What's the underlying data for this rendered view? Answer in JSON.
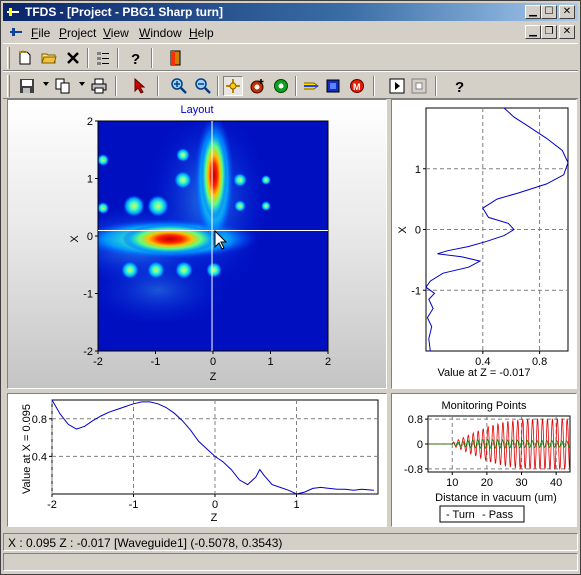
{
  "window": {
    "title": "TFDS - [Project - PBG1 Sharp turn]",
    "caption_buttons": [
      "minimize",
      "maximize",
      "close"
    ]
  },
  "menubar": {
    "items": [
      {
        "label": "File",
        "accel": "F",
        "rest": "ile"
      },
      {
        "label": "Project",
        "accel": "P",
        "rest": "roject"
      },
      {
        "label": "View",
        "accel": "V",
        "rest": "iew"
      },
      {
        "label": "Window",
        "accel": "W",
        "rest": "indow"
      },
      {
        "label": "Help",
        "accel": "H",
        "rest": "elp"
      }
    ]
  },
  "toolbar1": {
    "icons": [
      "new-file-icon",
      "open-folder-icon",
      "delete-icon",
      "properties-icon",
      "help-icon",
      "exit-icon"
    ]
  },
  "toolbar2": {
    "icons": [
      "save-icon",
      "copy-icon",
      "print-icon",
      "pointer-icon",
      "zoom-in-icon",
      "zoom-out-icon",
      "crosshair-icon",
      "add-source-icon",
      "add-monitor-icon",
      "waveguide-icon",
      "run-icon",
      "record-icon",
      "step-icon",
      "stop-icon",
      "help-icon"
    ],
    "pressed": "crosshair-icon"
  },
  "status": {
    "text": "X : 0.095  Z : -0.017 [Waveguide1] (-0.5078, 0.3543)"
  },
  "chart_data": [
    {
      "id": "layout",
      "type": "heatmap",
      "title": "Layout",
      "xlabel": "Z",
      "ylabel": "X",
      "xlim": [
        -2,
        2
      ],
      "ylim": [
        -2,
        2
      ],
      "xticks": [
        "-2",
        "-1",
        "0",
        "1",
        "2"
      ],
      "yticks": [
        "2",
        "1",
        "0",
        "-1",
        "-2"
      ],
      "crosshair": {
        "z": -0.017,
        "x": 0.095
      },
      "colormap": "jet"
    },
    {
      "id": "cross-x",
      "type": "line",
      "title": "",
      "xlabel": "Value at Z = -0.017",
      "ylabel": "X",
      "xticks": [
        "0.4",
        "0.8"
      ],
      "yticks": [
        "1",
        "0",
        "-1"
      ],
      "xlim": [
        0,
        1.0
      ],
      "ylim": [
        -2,
        2
      ],
      "series": [
        {
          "color": "#0000c8",
          "points": [
            [
              0.55,
              2.0
            ],
            [
              0.62,
              1.85
            ],
            [
              0.72,
              1.7
            ],
            [
              0.85,
              1.5
            ],
            [
              0.96,
              1.3
            ],
            [
              1.0,
              1.1
            ],
            [
              0.97,
              0.9
            ],
            [
              0.85,
              0.75
            ],
            [
              0.65,
              0.6
            ],
            [
              0.5,
              0.5
            ],
            [
              0.4,
              0.35
            ],
            [
              0.44,
              0.2
            ],
            [
              0.58,
              0.1
            ],
            [
              0.62,
              0.0
            ],
            [
              0.55,
              -0.1
            ],
            [
              0.42,
              -0.2
            ],
            [
              0.3,
              -0.28
            ],
            [
              0.15,
              -0.35
            ],
            [
              0.08,
              -0.4
            ],
            [
              0.25,
              -0.45
            ],
            [
              0.38,
              -0.52
            ],
            [
              0.3,
              -0.62
            ],
            [
              0.12,
              -0.72
            ],
            [
              0.03,
              -0.85
            ],
            [
              0.0,
              -0.95
            ],
            [
              0.06,
              -1.05
            ],
            [
              0.02,
              -1.15
            ],
            [
              0.05,
              -1.3
            ],
            [
              0.01,
              -1.45
            ],
            [
              0.04,
              -1.6
            ],
            [
              0.02,
              -1.8
            ],
            [
              0.03,
              -2.0
            ]
          ]
        }
      ]
    },
    {
      "id": "cross-z",
      "type": "line",
      "title": "",
      "xlabel": "Z",
      "ylabel": "Value at X = 0.095",
      "xticks": [
        "-2",
        "-1",
        "0",
        "1"
      ],
      "yticks": [
        "0.8",
        "0.4"
      ],
      "xlim": [
        -2,
        2
      ],
      "ylim": [
        0,
        1.0
      ],
      "series": [
        {
          "color": "#0000c8",
          "points": [
            [
              -2.0,
              1.0
            ],
            [
              -1.9,
              0.85
            ],
            [
              -1.8,
              0.74
            ],
            [
              -1.7,
              0.69
            ],
            [
              -1.6,
              0.72
            ],
            [
              -1.5,
              0.78
            ],
            [
              -1.4,
              0.83
            ],
            [
              -1.3,
              0.87
            ],
            [
              -1.2,
              0.9
            ],
            [
              -1.1,
              0.93
            ],
            [
              -1.0,
              0.96
            ],
            [
              -0.9,
              0.98
            ],
            [
              -0.8,
              0.98
            ],
            [
              -0.7,
              0.96
            ],
            [
              -0.6,
              0.92
            ],
            [
              -0.5,
              0.86
            ],
            [
              -0.4,
              0.78
            ],
            [
              -0.3,
              0.68
            ],
            [
              -0.2,
              0.56
            ],
            [
              -0.1,
              0.48
            ],
            [
              0.0,
              0.4
            ],
            [
              0.1,
              0.34
            ],
            [
              0.2,
              0.26
            ],
            [
              0.3,
              0.15
            ],
            [
              0.4,
              0.1
            ],
            [
              0.5,
              0.18
            ],
            [
              0.55,
              0.26
            ],
            [
              0.6,
              0.2
            ],
            [
              0.7,
              0.1
            ],
            [
              0.8,
              0.07
            ],
            [
              0.9,
              0.04
            ],
            [
              1.0,
              0.0
            ],
            [
              1.1,
              0.02
            ],
            [
              1.2,
              0.06
            ],
            [
              1.3,
              0.07
            ],
            [
              1.4,
              0.06
            ],
            [
              1.5,
              0.05
            ],
            [
              1.6,
              0.05
            ],
            [
              1.7,
              0.04
            ],
            [
              1.8,
              0.05
            ],
            [
              1.95,
              0.04
            ]
          ]
        }
      ]
    },
    {
      "id": "monitoring",
      "type": "line",
      "title": "Monitoring Points",
      "xlabel": "Distance in vacuum (um)",
      "ylabel": "",
      "xticks": [
        "10",
        "20",
        "30",
        "40"
      ],
      "yticks": [
        "0.8",
        "0",
        "-0.8"
      ],
      "xlim": [
        3,
        44
      ],
      "ylim": [
        -0.9,
        0.9
      ],
      "legend": [
        "- Turn",
        "- Pass"
      ],
      "series": [
        {
          "name": "Turn",
          "color": "#e00000",
          "envelope": [
            [
              10,
              0.05
            ],
            [
              15,
              0.3
            ],
            [
              20,
              0.55
            ],
            [
              25,
              0.72
            ],
            [
              30,
              0.8
            ],
            [
              35,
              0.82
            ],
            [
              44,
              0.82
            ]
          ]
        },
        {
          "name": "Pass",
          "color": "#008000",
          "envelope": [
            [
              10,
              0.03
            ],
            [
              15,
              0.12
            ],
            [
              20,
              0.15
            ],
            [
              30,
              0.12
            ],
            [
              44,
              0.1
            ]
          ]
        }
      ]
    }
  ]
}
